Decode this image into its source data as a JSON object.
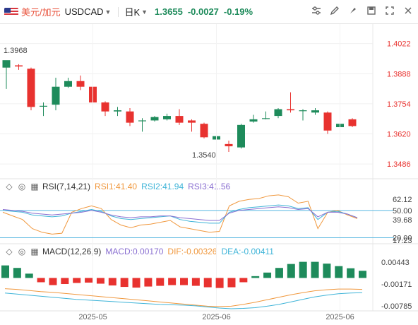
{
  "header": {
    "symbol_cn": "美元/加元",
    "symbol": "USDCAD",
    "period": "日K",
    "price": "1.3655",
    "change": "-0.0027",
    "change_pct": "-0.19%"
  },
  "colors": {
    "up": "#e8322f",
    "down": "#1e8b5b",
    "rsi1": "#f0983e",
    "rsi2": "#3fb4d8",
    "rsi3": "#8a6fd1",
    "dif": "#f0983e",
    "dea": "#3fb4d8"
  },
  "icons": [
    "flag-us-icon",
    "caret-down-icon",
    "indicator-settings-icon",
    "draw-tool-icon",
    "compare-icon",
    "brush-icon",
    "save-icon",
    "fullscreen-icon",
    "close-icon"
  ],
  "chart_data": [
    {
      "type": "candlestick",
      "y_ticks": [
        "1.4022",
        "1.3888",
        "1.3754",
        "1.3620",
        "1.3486"
      ],
      "ylim": [
        1.343,
        1.409
      ],
      "x_ticks": [
        {
          "label": "2025-05",
          "index": 7
        },
        {
          "label": "2025-06",
          "index": 17
        },
        {
          "label": "2025-06",
          "index": 27
        }
      ],
      "annotations": {
        "high": "1.3968",
        "low": "1.3540"
      },
      "candles": [
        {
          "o": 1.3915,
          "h": 1.394,
          "c": 1.3948,
          "l": 1.382
        },
        {
          "o": 1.3925,
          "h": 1.393,
          "c": 1.392,
          "l": 1.3905
        },
        {
          "o": 1.391,
          "h": 1.3915,
          "c": 1.374,
          "l": 1.3725
        },
        {
          "o": 1.3745,
          "h": 1.376,
          "c": 1.3745,
          "l": 1.37
        },
        {
          "o": 1.375,
          "h": 1.387,
          "c": 1.383,
          "l": 1.3725
        },
        {
          "o": 1.383,
          "h": 1.387,
          "c": 1.3855,
          "l": 1.3825
        },
        {
          "o": 1.3855,
          "h": 1.388,
          "c": 1.383,
          "l": 1.3815
        },
        {
          "o": 1.383,
          "h": 1.3835,
          "c": 1.376,
          "l": 1.373
        },
        {
          "o": 1.376,
          "h": 1.3765,
          "c": 1.372,
          "l": 1.37
        },
        {
          "o": 1.372,
          "h": 1.374,
          "c": 1.3725,
          "l": 1.37
        },
        {
          "o": 1.372,
          "h": 1.3735,
          "c": 1.367,
          "l": 1.3655
        },
        {
          "o": 1.368,
          "h": 1.369,
          "c": 1.368,
          "l": 1.363
        },
        {
          "o": 1.368,
          "h": 1.37,
          "c": 1.3695,
          "l": 1.3675
        },
        {
          "o": 1.3685,
          "h": 1.371,
          "c": 1.37,
          "l": 1.368
        },
        {
          "o": 1.37,
          "h": 1.373,
          "c": 1.367,
          "l": 1.366
        },
        {
          "o": 1.368,
          "h": 1.3685,
          "c": 1.367,
          "l": 1.363
        },
        {
          "o": 1.3665,
          "h": 1.367,
          "c": 1.3605,
          "l": 1.36
        },
        {
          "o": 1.3595,
          "h": 1.3625,
          "c": 1.361,
          "l": 1.356
        },
        {
          "o": 1.3575,
          "h": 1.359,
          "c": 1.3565,
          "l": 1.354
        },
        {
          "o": 1.356,
          "h": 1.3665,
          "c": 1.366,
          "l": 1.3555
        },
        {
          "o": 1.3675,
          "h": 1.3705,
          "c": 1.3685,
          "l": 1.367
        },
        {
          "o": 1.369,
          "h": 1.372,
          "c": 1.369,
          "l": 1.3685
        },
        {
          "o": 1.37,
          "h": 1.3735,
          "c": 1.373,
          "l": 1.369
        },
        {
          "o": 1.373,
          "h": 1.3805,
          "c": 1.3725,
          "l": 1.3715
        },
        {
          "o": 1.3725,
          "h": 1.373,
          "c": 1.3725,
          "l": 1.368
        },
        {
          "o": 1.3715,
          "h": 1.3735,
          "c": 1.3725,
          "l": 1.3705
        },
        {
          "o": 1.3715,
          "h": 1.372,
          "c": 1.3635,
          "l": 1.362
        },
        {
          "o": 1.365,
          "h": 1.376,
          "c": 1.3665,
          "l": 1.3635
        },
        {
          "o": 1.3685,
          "h": 1.369,
          "c": 1.3655,
          "l": 1.365
        }
      ]
    },
    {
      "type": "line",
      "name": "RSI(7,14,21)",
      "labels": {
        "rsi1": "RSI1:41.40",
        "rsi2": "RSI2:41.94",
        "rsi3": "RSI3:41.56"
      },
      "y_ticks": [
        "62.12",
        "50.00",
        "39.68",
        "17.23",
        "20.00"
      ],
      "ylim": [
        15,
        70
      ],
      "reference_lines": [
        50,
        20
      ],
      "series": [
        {
          "key": "rsi1",
          "values": [
            48,
            44,
            40,
            30,
            26,
            24,
            25,
            48,
            52,
            55,
            52,
            40,
            34,
            31,
            34,
            35,
            37,
            39,
            32,
            30,
            28,
            26,
            27,
            55,
            60,
            62,
            63,
            66,
            67,
            65,
            58,
            60,
            30,
            48,
            50,
            45,
            41
          ]
        },
        {
          "key": "rsi2",
          "values": [
            50,
            49,
            48,
            45,
            44,
            43,
            44,
            47,
            49,
            51,
            49,
            44,
            41,
            40,
            41,
            42,
            43,
            44,
            40,
            38,
            37,
            36,
            36,
            48,
            51,
            53,
            54,
            55,
            56,
            55,
            52,
            53,
            40,
            48,
            49,
            46,
            42
          ]
        },
        {
          "key": "rsi3",
          "values": [
            51,
            50,
            49,
            47,
            46,
            45,
            46,
            47,
            48,
            50,
            48,
            45,
            43,
            42,
            43,
            43,
            44,
            44,
            42,
            41,
            40,
            39,
            39,
            47,
            50,
            51,
            52,
            53,
            54,
            53,
            51,
            52,
            43,
            48,
            48,
            46,
            42
          ]
        }
      ]
    },
    {
      "type": "bar",
      "name": "MACD(12,26,9)",
      "labels": {
        "macd": "MACD:0.00170",
        "dif": "DIF:-0.00326",
        "dea": "DEA:-0.00411"
      },
      "y_ticks": [
        "0.00443",
        "-0.00171",
        "-0.00785"
      ],
      "ylim": [
        -0.0088,
        0.0058
      ],
      "macd": [
        0.0035,
        0.0028,
        0.0012,
        -0.0012,
        -0.002,
        -0.0017,
        -0.0014,
        -0.0013,
        -0.0016,
        -0.0021,
        -0.0025,
        -0.0027,
        -0.0024,
        -0.0022,
        -0.002,
        -0.002,
        -0.0022,
        -0.0026,
        -0.0028,
        -0.0026,
        -0.0012,
        0.0005,
        0.0015,
        0.0028,
        0.0039,
        0.0045,
        0.0045,
        0.004,
        0.0033,
        0.0027,
        0.002
      ],
      "dif": [
        -0.003,
        -0.0032,
        -0.0035,
        -0.0038,
        -0.004,
        -0.0043,
        -0.0046,
        -0.0049,
        -0.0052,
        -0.0055,
        -0.0058,
        -0.0061,
        -0.0064,
        -0.0067,
        -0.007,
        -0.0073,
        -0.0076,
        -0.0079,
        -0.008,
        -0.0079,
        -0.0074,
        -0.0068,
        -0.0061,
        -0.0054,
        -0.0047,
        -0.0041,
        -0.0036,
        -0.0033,
        -0.0031,
        -0.0031,
        -0.0032
      ],
      "dea": [
        -0.0042,
        -0.0045,
        -0.0048,
        -0.0051,
        -0.0054,
        -0.0057,
        -0.006,
        -0.0062,
        -0.0064,
        -0.0066,
        -0.0068,
        -0.007,
        -0.0072,
        -0.0074,
        -0.0075,
        -0.0076,
        -0.0078,
        -0.0081,
        -0.0084,
        -0.0086,
        -0.0085,
        -0.0083,
        -0.0079,
        -0.0074,
        -0.0067,
        -0.006,
        -0.0053,
        -0.0048,
        -0.0044,
        -0.0042,
        -0.0041
      ]
    }
  ]
}
